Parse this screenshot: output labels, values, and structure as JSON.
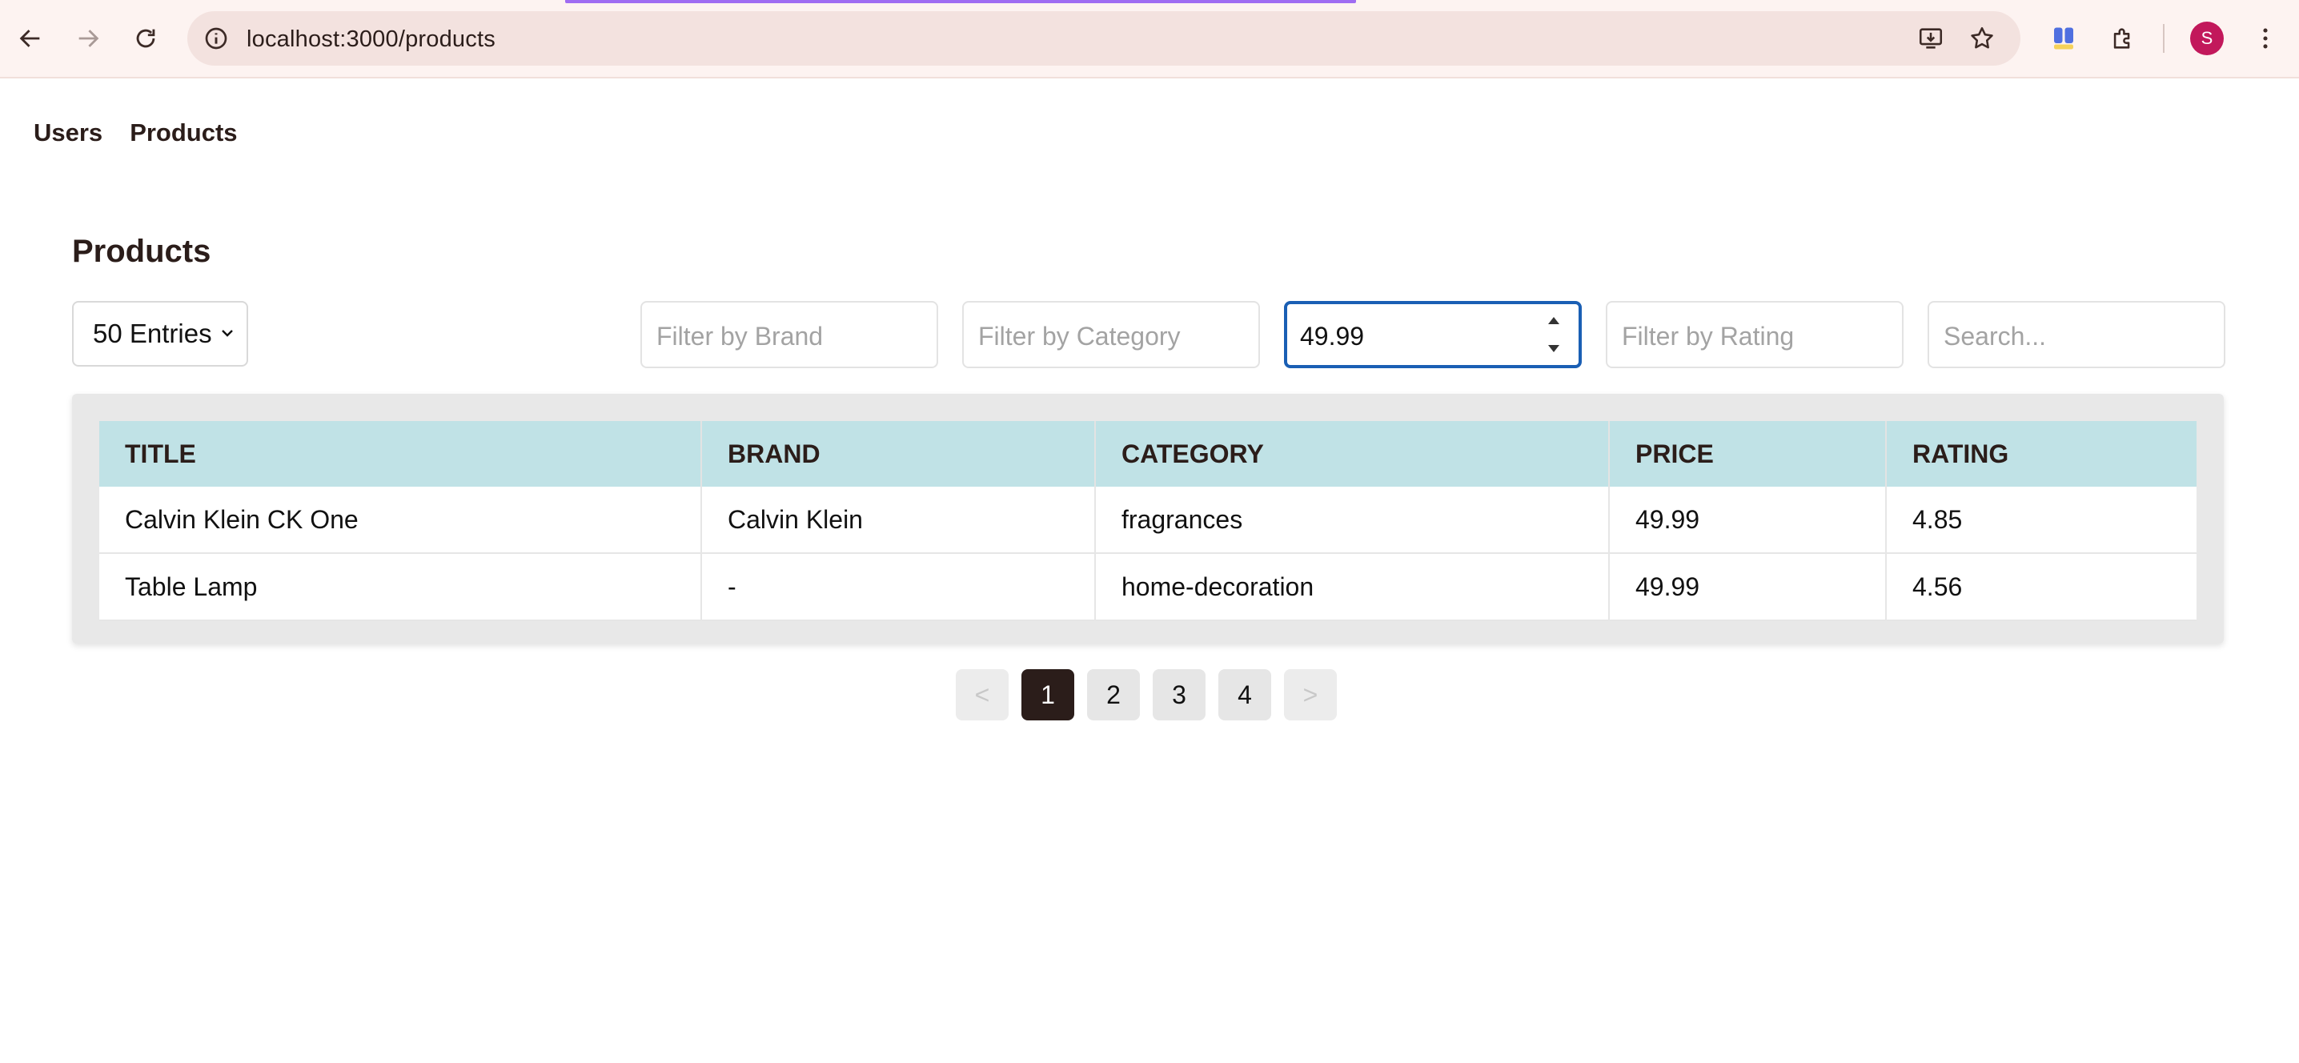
{
  "browser": {
    "url": "localhost:3000/products",
    "profile_initial": "S",
    "accent_color": "#9f6cf2",
    "icons": [
      "back-icon",
      "forward-icon",
      "reload-icon",
      "site-info-icon",
      "install-app-icon",
      "bookmark-star-icon",
      "extension-app-icon",
      "puzzle-icon",
      "menu-kebab-icon"
    ]
  },
  "nav": {
    "users": "Users",
    "products": "Products"
  },
  "page": {
    "title": "Products"
  },
  "controls": {
    "entries": "50 Entries",
    "filter_brand_placeholder": "Filter by Brand",
    "filter_category_placeholder": "Filter by Category",
    "filter_price_value": "49.99",
    "filter_rating_placeholder": "Filter by Rating",
    "search_placeholder": "Search..."
  },
  "table": {
    "headers": [
      "TITLE",
      "BRAND",
      "CATEGORY",
      "PRICE",
      "RATING"
    ],
    "header_color": "#c0e2e6",
    "rows": [
      [
        "Calvin Klein CK One",
        "Calvin Klein",
        "fragrances",
        "49.99",
        "4.85"
      ],
      [
        "Table Lamp",
        "-",
        "home-decoration",
        "49.99",
        "4.56"
      ]
    ]
  },
  "pagination": {
    "prev": "<",
    "pages": [
      "1",
      "2",
      "3",
      "4"
    ],
    "current": "1",
    "next": ">"
  }
}
